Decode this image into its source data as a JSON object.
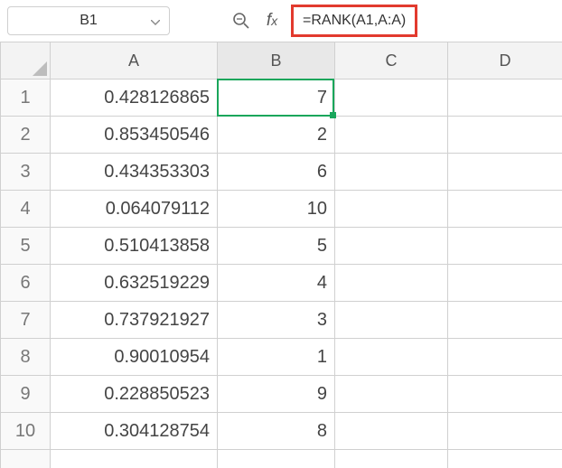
{
  "toolbar": {
    "cell_reference": "B1",
    "formula": "=RANK(A1,A:A)"
  },
  "columns": [
    "A",
    "B",
    "C",
    "D"
  ],
  "rows": [
    {
      "n": "1",
      "A": "0.428126865",
      "B": "7"
    },
    {
      "n": "2",
      "A": "0.853450546",
      "B": "2"
    },
    {
      "n": "3",
      "A": "0.434353303",
      "B": "6"
    },
    {
      "n": "4",
      "A": "0.064079112",
      "B": "10"
    },
    {
      "n": "5",
      "A": "0.510413858",
      "B": "5"
    },
    {
      "n": "6",
      "A": "0.632519229",
      "B": "4"
    },
    {
      "n": "7",
      "A": "0.737921927",
      "B": "3"
    },
    {
      "n": "8",
      "A": "0.90010954",
      "B": "1"
    },
    {
      "n": "9",
      "A": "0.228850523",
      "B": "9"
    },
    {
      "n": "10",
      "A": "0.304128754",
      "B": "8"
    }
  ],
  "selection": {
    "cell": "B1"
  }
}
